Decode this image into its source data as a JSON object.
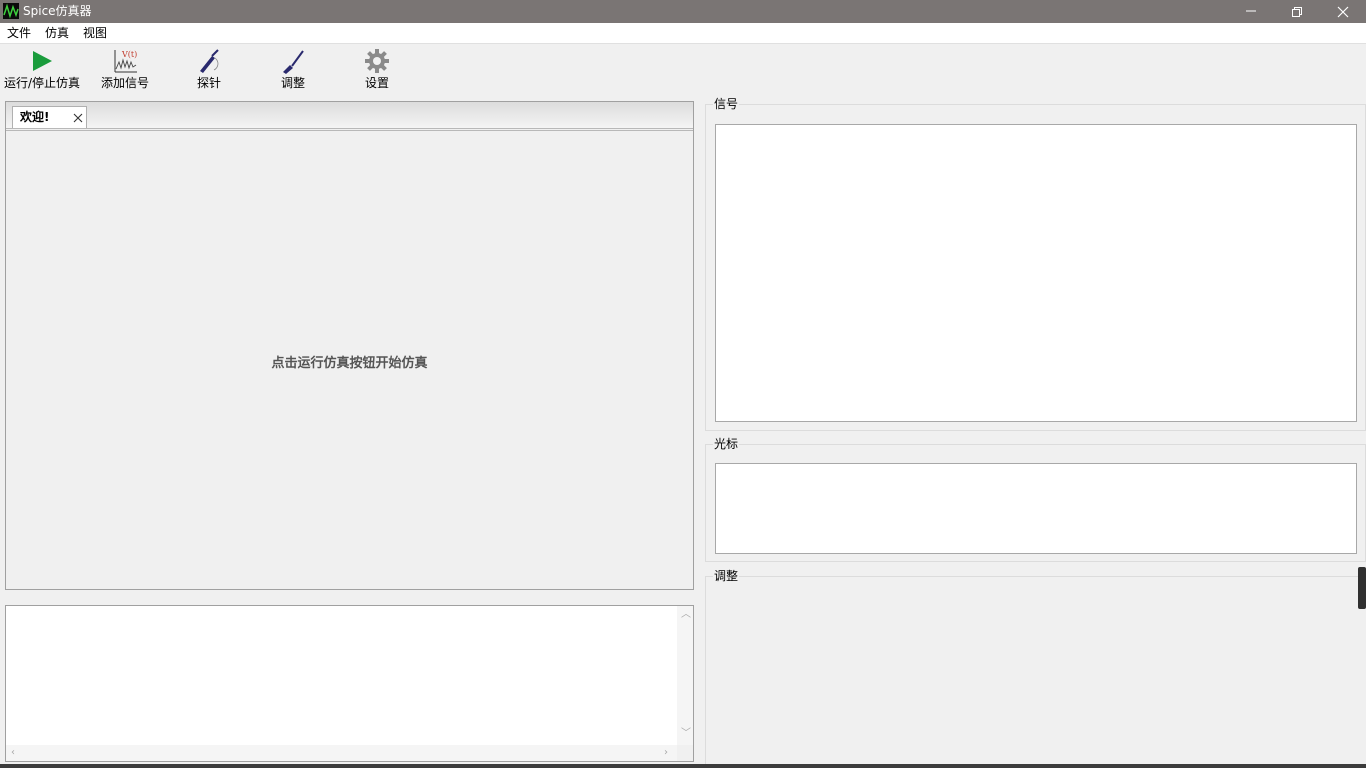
{
  "window": {
    "title": "Spice仿真器",
    "controls": [
      "minimize-icon",
      "restore-icon",
      "close-icon"
    ]
  },
  "menu": {
    "items": [
      "文件",
      "仿真",
      "视图"
    ]
  },
  "toolbar": {
    "run_stop": "运行/停止仿真",
    "add_signal": "添加信号",
    "probe": "探针",
    "tune": "调整",
    "settings": "设置"
  },
  "tabs": [
    {
      "label": "欢迎!"
    }
  ],
  "welcome": {
    "hint": "点击运行仿真按钮开始仿真"
  },
  "panels": {
    "signals_title": "信号",
    "cursors_title": "光标",
    "tune_title": "调整"
  },
  "colors": {
    "titlebar": "#7a7574",
    "run_icon": "#1a9c3c",
    "probe_icon": "#2a2a6e"
  }
}
